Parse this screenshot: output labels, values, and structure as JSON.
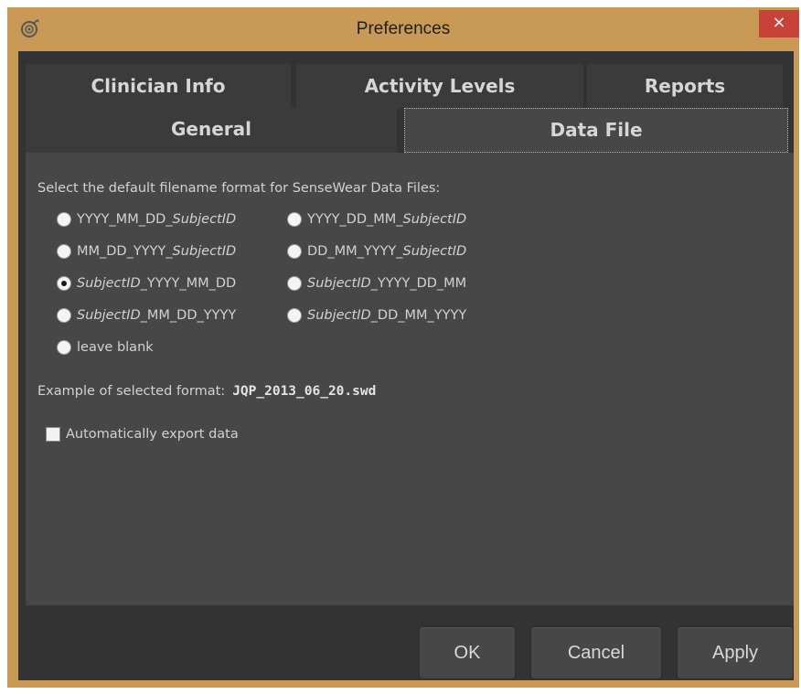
{
  "window": {
    "title": "Preferences",
    "close_glyph": "×",
    "app_icon": "sensewear-app-icon",
    "colors": {
      "frame": "#c89a56",
      "close": "#c7433a",
      "client": "#333333",
      "panel": "#474747"
    }
  },
  "tabs": {
    "row1": [
      {
        "label": "Clinician Info"
      },
      {
        "label": "Activity Levels"
      },
      {
        "label": "Reports"
      }
    ],
    "row2": [
      {
        "label": "General"
      },
      {
        "label": "Data File",
        "active": true
      }
    ]
  },
  "panel": {
    "section_label": "Select the default filename format for SenseWear Data Files:",
    "options": [
      {
        "parts": [
          "YYYY_MM_DD_",
          "SubjectID"
        ],
        "italic": [
          false,
          true
        ],
        "checked": false
      },
      {
        "parts": [
          "YYYY_DD_MM_",
          "SubjectID"
        ],
        "italic": [
          false,
          true
        ],
        "checked": false
      },
      {
        "parts": [
          "MM_DD_YYYY_",
          "SubjectID"
        ],
        "italic": [
          false,
          true
        ],
        "checked": false
      },
      {
        "parts": [
          "DD_MM_YYYY_",
          "SubjectID"
        ],
        "italic": [
          false,
          true
        ],
        "checked": false
      },
      {
        "parts": [
          "SubjectID",
          "_YYYY_MM_DD"
        ],
        "italic": [
          true,
          false
        ],
        "checked": true
      },
      {
        "parts": [
          "SubjectID",
          "_YYYY_DD_MM"
        ],
        "italic": [
          true,
          false
        ],
        "checked": false
      },
      {
        "parts": [
          "SubjectID",
          "_MM_DD_YYYY"
        ],
        "italic": [
          true,
          false
        ],
        "checked": false
      },
      {
        "parts": [
          "SubjectID",
          "_DD_MM_YYYY"
        ],
        "italic": [
          true,
          false
        ],
        "checked": false
      },
      {
        "parts": [
          "leave blank"
        ],
        "italic": [
          false
        ],
        "checked": false
      }
    ],
    "example_label": "Example of selected format:",
    "example_value": "JQP_2013_06_20.swd",
    "auto_export_label": "Automatically export data",
    "auto_export_checked": false
  },
  "buttons": {
    "ok": "OK",
    "cancel": "Cancel",
    "apply": "Apply"
  }
}
